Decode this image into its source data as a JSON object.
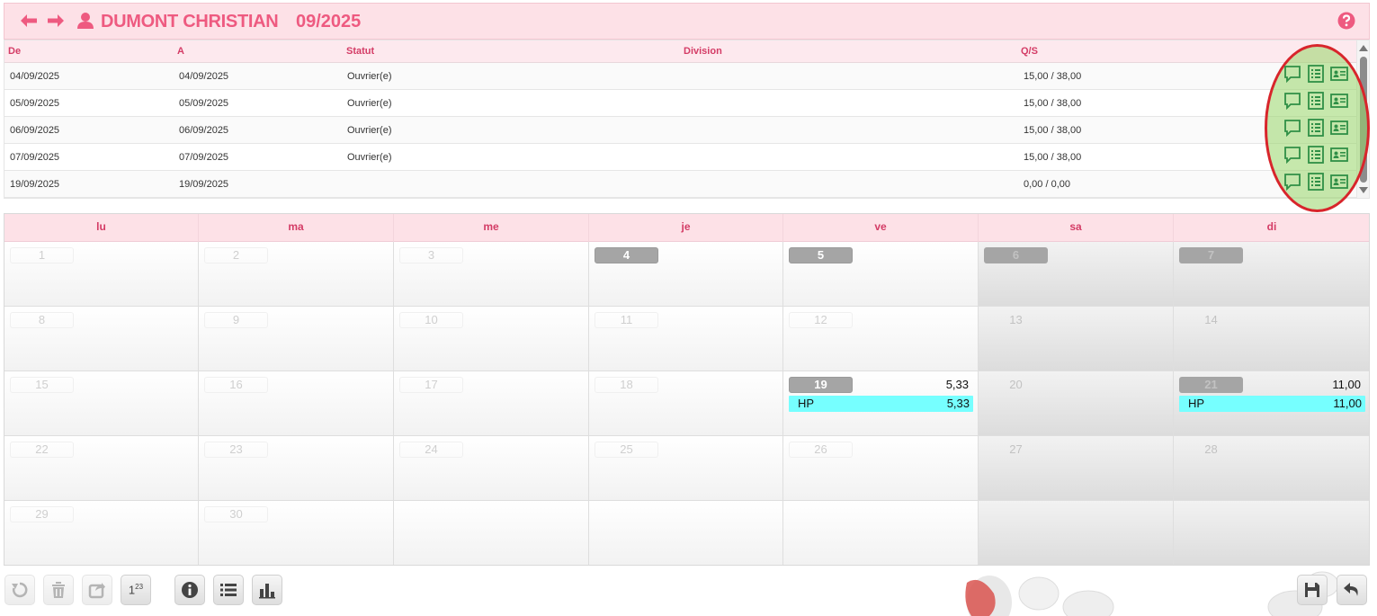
{
  "header": {
    "employee_name": "DUMONT CHRISTIAN",
    "period": "09/2025",
    "icons": [
      "arrow-left-icon",
      "arrow-right-icon",
      "user-icon",
      "help-icon"
    ]
  },
  "grid": {
    "columns": [
      "De",
      "A",
      "Statut",
      "Division",
      "Q/S"
    ],
    "rows": [
      {
        "de": "04/09/2025",
        "a": "04/09/2025",
        "statut": "Ouvrier(e)",
        "division": "",
        "qs": "15,00 / 38,00"
      },
      {
        "de": "05/09/2025",
        "a": "05/09/2025",
        "statut": "Ouvrier(e)",
        "division": "",
        "qs": "15,00 / 38,00"
      },
      {
        "de": "06/09/2025",
        "a": "06/09/2025",
        "statut": "Ouvrier(e)",
        "division": "",
        "qs": "15,00 / 38,00"
      },
      {
        "de": "07/09/2025",
        "a": "07/09/2025",
        "statut": "Ouvrier(e)",
        "division": "",
        "qs": "15,00 / 38,00"
      },
      {
        "de": "19/09/2025",
        "a": "19/09/2025",
        "statut": "",
        "division": "",
        "qs": "0,00 / 0,00"
      }
    ],
    "row_icons": [
      "comment-icon",
      "list-icon",
      "id-card-icon"
    ]
  },
  "calendar": {
    "day_names": [
      "lu",
      "ma",
      "me",
      "je",
      "ve",
      "sa",
      "di"
    ],
    "weeks": [
      [
        {
          "day": "1"
        },
        {
          "day": "2"
        },
        {
          "day": "3"
        },
        {
          "day": "4",
          "active": true
        },
        {
          "day": "5",
          "active": true
        },
        {
          "day": "6",
          "active": true
        },
        {
          "day": "7",
          "active": true
        }
      ],
      [
        {
          "day": "8"
        },
        {
          "day": "9"
        },
        {
          "day": "10"
        },
        {
          "day": "11"
        },
        {
          "day": "12"
        },
        {
          "day": "13"
        },
        {
          "day": "14"
        }
      ],
      [
        {
          "day": "15"
        },
        {
          "day": "16"
        },
        {
          "day": "17"
        },
        {
          "day": "18"
        },
        {
          "day": "19",
          "active": true,
          "value": "5,33",
          "event": {
            "label": "HP",
            "value": "5,33"
          }
        },
        {
          "day": "20"
        },
        {
          "day": "21",
          "active": true,
          "value": "11,00",
          "event": {
            "label": "HP",
            "value": "11,00"
          }
        }
      ],
      [
        {
          "day": "22"
        },
        {
          "day": "23"
        },
        {
          "day": "24"
        },
        {
          "day": "25"
        },
        {
          "day": "26"
        },
        {
          "day": "27"
        },
        {
          "day": "28"
        }
      ],
      [
        {
          "day": "29"
        },
        {
          "day": "30"
        },
        {
          "day": ""
        },
        {
          "day": ""
        },
        {
          "day": ""
        },
        {
          "day": ""
        },
        {
          "day": ""
        }
      ]
    ]
  },
  "toolbar": {
    "buttons": [
      {
        "name": "undo-button",
        "icon": "undo-icon",
        "disabled": true
      },
      {
        "name": "delete-button",
        "icon": "trash-icon",
        "disabled": true
      },
      {
        "name": "export-button",
        "icon": "share-icon",
        "disabled": true
      },
      {
        "name": "numbering-button",
        "text": "1",
        "sup": "23"
      },
      {
        "name": "info-button",
        "icon": "info-icon"
      },
      {
        "name": "list-button",
        "icon": "list-icon"
      },
      {
        "name": "chart-button",
        "icon": "bar-chart-icon"
      },
      {
        "name": "save-button",
        "icon": "save-icon"
      },
      {
        "name": "back-button",
        "icon": "return-icon"
      }
    ]
  },
  "colors": {
    "accent": "#ee5a80",
    "header_bg": "#fde1e7",
    "event_bg": "#76ffff",
    "highlight_ring": "#d8252b",
    "icon_green": "#2f8f46"
  }
}
